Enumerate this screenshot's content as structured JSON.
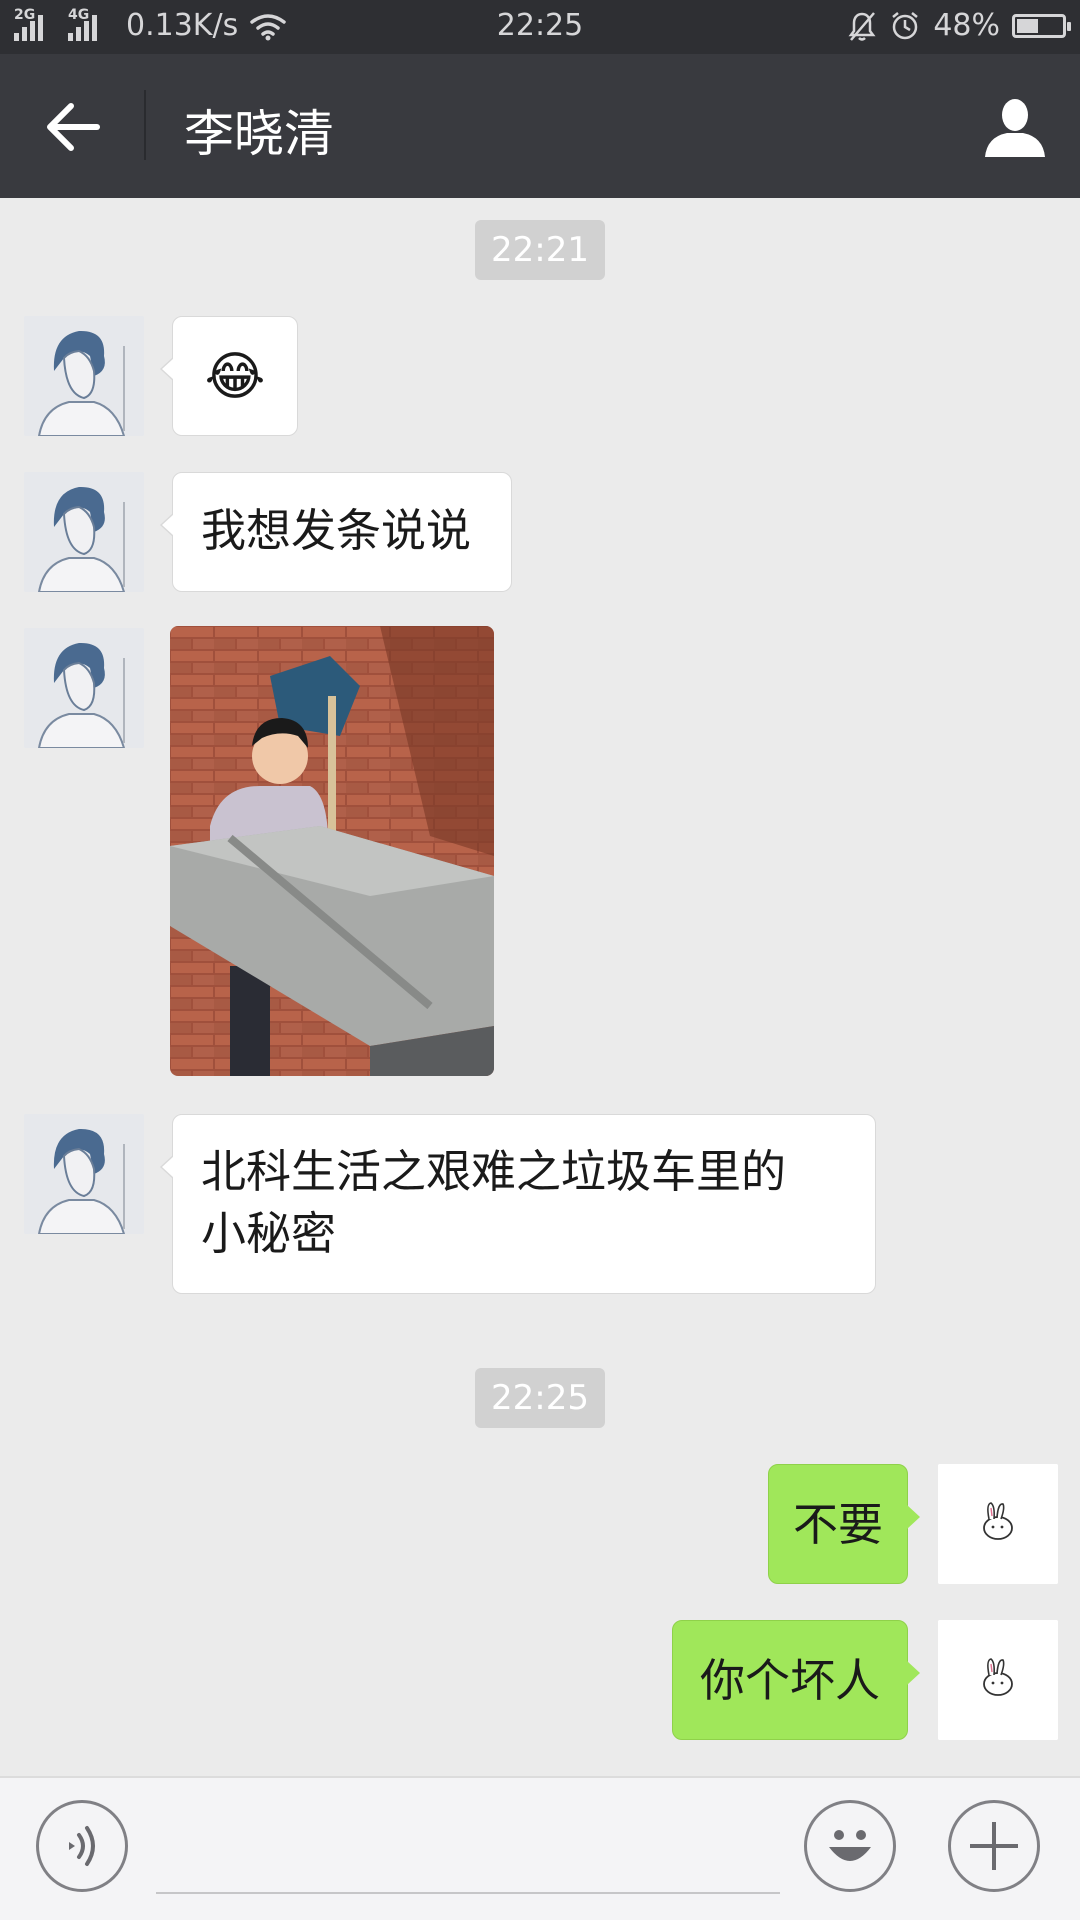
{
  "status_bar": {
    "network_1": "2G",
    "network_2": "4G",
    "speed": "0.13K/s",
    "time": "22:25",
    "battery": "48%",
    "battery_level": 0.48
  },
  "header": {
    "title": "李晓清",
    "back_icon": "arrow-left-icon",
    "profile_icon": "person-icon"
  },
  "messages": {
    "ts1": "22:21",
    "m1_text": "😂",
    "m2_text": "我想发条说说",
    "m4_line1": "北科生活之艰难之垃圾车里的",
    "m4_line2": "小秘密",
    "ts2": "22:25",
    "m5_text": "不要",
    "m6_text": "你个坏人"
  },
  "input_bar": {
    "voice_icon": "voice-icon",
    "emoji_icon": "emoji-icon",
    "more_icon": "plus-icon",
    "placeholder": ""
  },
  "colors": {
    "titlebar": "#393a3f",
    "chat_bg": "#ebebeb",
    "self_bubble": "#a0e75a"
  }
}
